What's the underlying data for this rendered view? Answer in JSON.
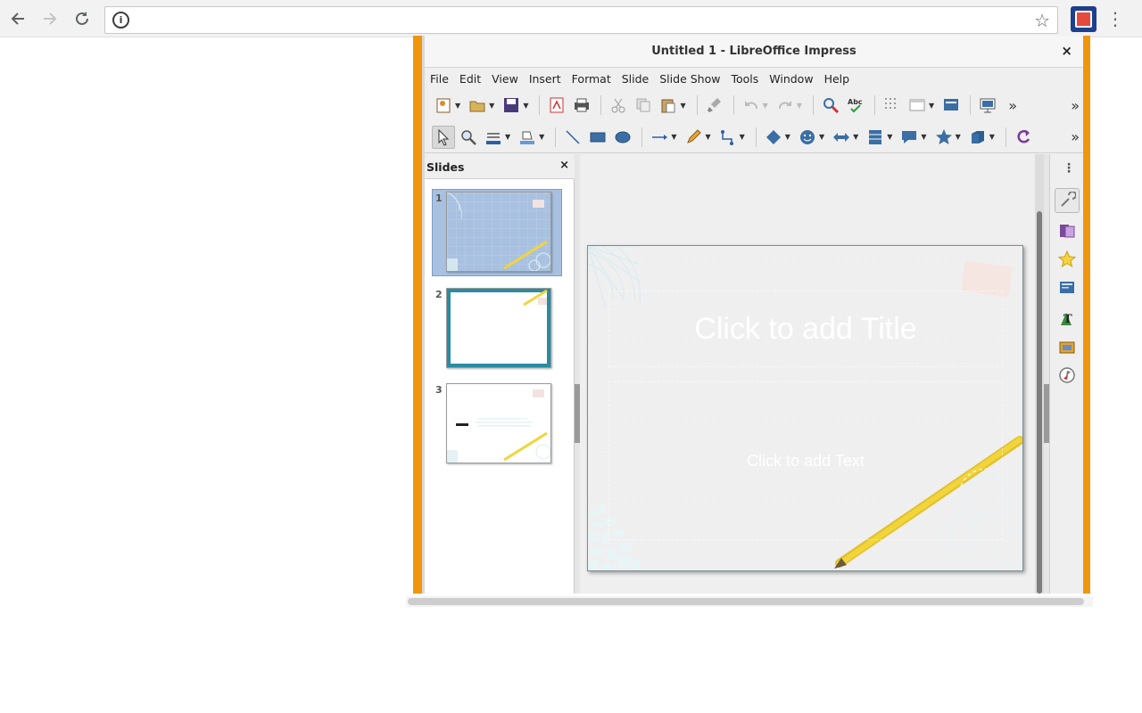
{
  "browser": {
    "back_icon": "arrow-left-icon",
    "forward_icon": "arrow-right-icon",
    "reload_icon": "reload-icon",
    "address_value": "",
    "info_glyph": "i",
    "bookmark_icon": "star-icon",
    "menu_glyph": "⋮"
  },
  "window": {
    "title": "Untitled 1 - LibreOffice Impress",
    "close_glyph": "×"
  },
  "menu": [
    "File",
    "Edit",
    "View",
    "Insert",
    "Format",
    "Slide",
    "Slide Show",
    "Tools",
    "Window",
    "Help"
  ],
  "slides_panel": {
    "heading": "Slides",
    "close_glyph": "×",
    "thumbnails": [
      {
        "number": "1",
        "selected": true,
        "style": "teal"
      },
      {
        "number": "2",
        "selected": false,
        "style": "white"
      },
      {
        "number": "3",
        "selected": false,
        "style": "teal-text"
      }
    ]
  },
  "slide": {
    "title_placeholder": "Click to add Title",
    "body_placeholder": "Click to add Text"
  },
  "sidebar": {
    "menu_glyph": "⋮",
    "buttons": [
      "properties-icon",
      "slide-transition-icon",
      "animation-icon",
      "master-slides-icon",
      "styles-icon",
      "gallery-icon",
      "navigator-icon"
    ]
  },
  "colors": {
    "frame_accent": "#f0950e",
    "slide_teal": "#2a8ba1",
    "pencil_yellow": "#f2d43b"
  }
}
